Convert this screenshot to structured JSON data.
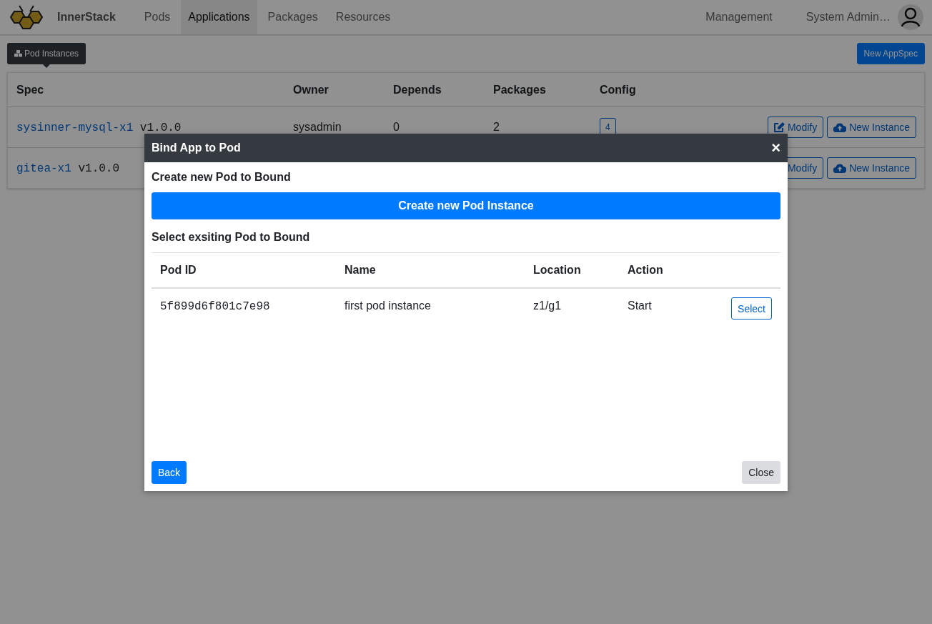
{
  "navbar": {
    "brand": "InnerStack",
    "items": [
      {
        "label": "Pods",
        "selected": false
      },
      {
        "label": "Applications",
        "selected": true
      },
      {
        "label": "Packages",
        "selected": false
      },
      {
        "label": "Resources",
        "selected": false
      }
    ],
    "management": "Management",
    "user": "System Admin…"
  },
  "toolbar": {
    "pod_instances_button": "Pod Instances",
    "new_button": "New AppSpec"
  },
  "table": {
    "columns": [
      "Spec",
      "Owner",
      "Depends",
      "Packages",
      "Config"
    ],
    "rows": [
      {
        "spec": "sysinner-mysql-x1",
        "version": "v1.0.0",
        "owner": "sysadmin",
        "depends": "0",
        "packages": "2",
        "config": "4",
        "modify": "Modify",
        "new_instance": "New Instance"
      },
      {
        "spec": "gitea-x1",
        "version": "v1.0.0",
        "modify": "Modify",
        "new_instance": "New Instance"
      }
    ]
  },
  "modal": {
    "title": "Bind App to Pod",
    "close": "×",
    "create_heading": "Create new Pod to Bound",
    "create_button": "Create new Pod Instance",
    "select_heading": "Select exsiting Pod to Bound",
    "columns": [
      "Pod ID",
      "Name",
      "Location",
      "Action"
    ],
    "rows": [
      {
        "pod_id": "5f899d6f801c7e98",
        "name": "first pod instance",
        "location": "z1/g1",
        "action": "Start",
        "button": "Select"
      }
    ],
    "back": "Back",
    "close_button": "Close"
  }
}
